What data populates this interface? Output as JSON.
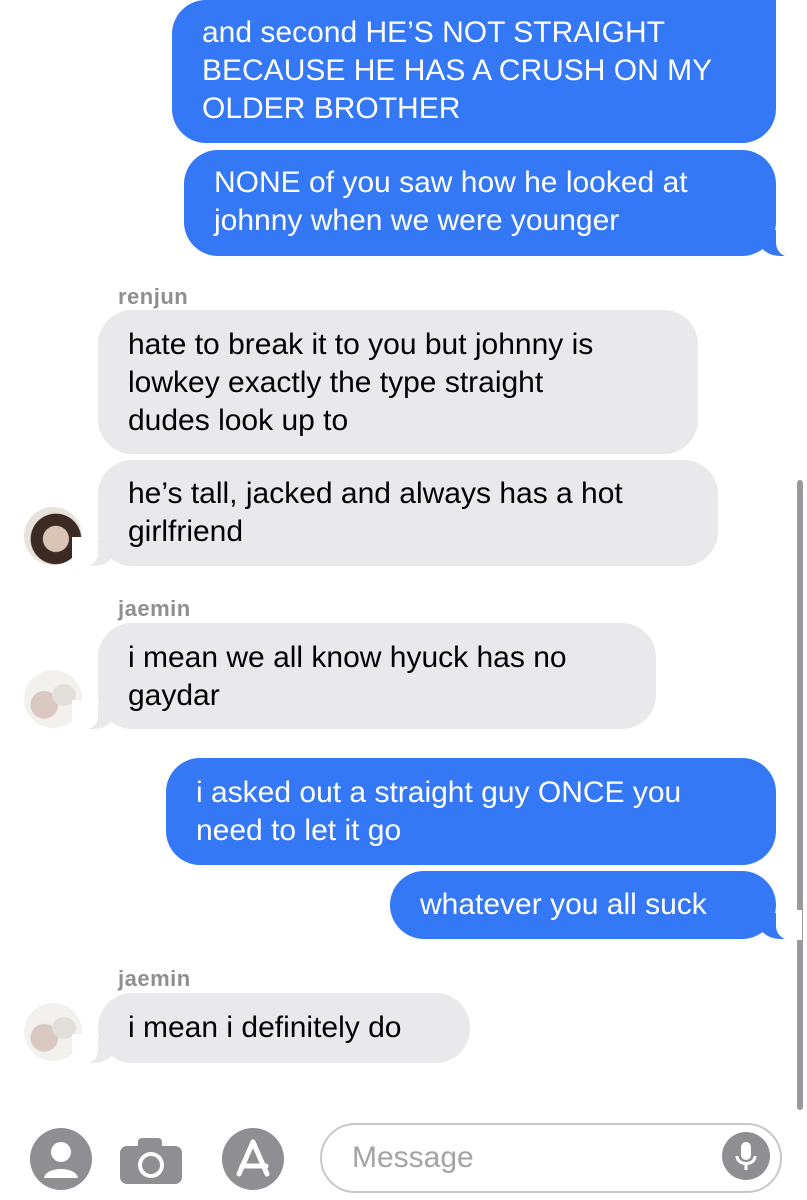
{
  "messages": [
    {
      "from": "me",
      "text_lines": [
        "and second HE’S NOT STRAIGHT",
        "BECAUSE HE HAS A CRUSH ON MY",
        "OLDER BROTHER"
      ]
    },
    {
      "from": "me",
      "text_lines": [
        "NONE of you saw how he looked at",
        "johnny when we were younger"
      ]
    },
    {
      "from": "renjun",
      "sender_label": "renjun",
      "text_lines": [
        "hate to break it to you but johnny is",
        "lowkey exactly the type straight",
        "dudes look up to"
      ]
    },
    {
      "from": "renjun",
      "text_lines": [
        "he’s tall, jacked and always has a hot",
        "girlfriend"
      ]
    },
    {
      "from": "jaemin",
      "sender_label": "jaemin",
      "text_lines": [
        "i mean we all know hyuck has no",
        "gaydar"
      ]
    },
    {
      "from": "me",
      "text_lines": [
        "i asked out a straight guy ONCE you",
        "need to let it go"
      ]
    },
    {
      "from": "me",
      "text_lines": [
        "whatever you all suck"
      ]
    },
    {
      "from": "jaemin",
      "sender_label": "jaemin",
      "text_lines": [
        "i mean i definitely do"
      ]
    }
  ],
  "input": {
    "placeholder": "Message"
  },
  "icons": {
    "contact": "person-circle-icon",
    "camera": "camera-icon",
    "apps": "app-store-icon",
    "mic": "microphone-icon"
  },
  "colors": {
    "outgoing": "#3478f6",
    "incoming": "#e9e9eb",
    "sender_label": "#8e8e93"
  }
}
